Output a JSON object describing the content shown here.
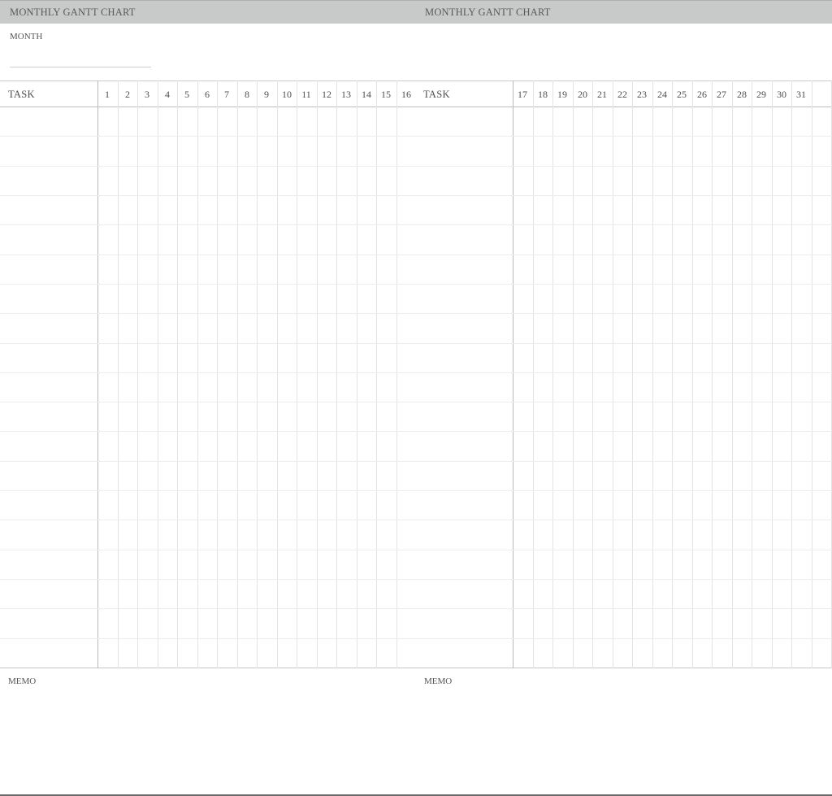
{
  "header": {
    "left_title": "MONTHLY GANTT CHART",
    "right_title": "MONTHLY GANTT CHART"
  },
  "month": {
    "label": "MONTH",
    "value": ""
  },
  "left_panel": {
    "task_header": "TASK",
    "days": [
      "1",
      "2",
      "3",
      "4",
      "5",
      "6",
      "7",
      "8",
      "9",
      "10",
      "11",
      "12",
      "13",
      "14",
      "15",
      "16"
    ]
  },
  "right_panel": {
    "task_header": "TASK",
    "days": [
      "17",
      "18",
      "19",
      "20",
      "21",
      "22",
      "23",
      "24",
      "25",
      "26",
      "27",
      "28",
      "29",
      "30",
      "31",
      ""
    ]
  },
  "task_rows": 19,
  "memo": {
    "left_label": "MEMO",
    "right_label": "MEMO"
  },
  "colors": {
    "header_band": "#c8c9c9",
    "grid_major": "#bdbdbd",
    "grid_minor": "#e3e3e3",
    "text": "#555555"
  }
}
